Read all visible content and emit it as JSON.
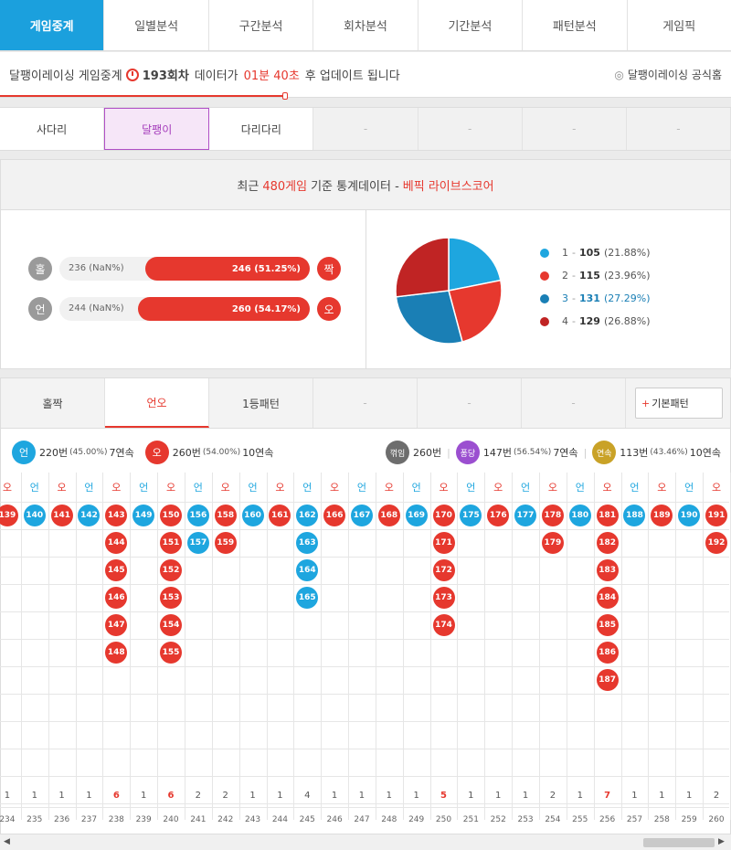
{
  "nav": {
    "tabs": [
      "게임중계",
      "일별분석",
      "구간분석",
      "회차분석",
      "기간분석",
      "패턴분석",
      "게임픽"
    ],
    "active": 0
  },
  "info": {
    "prefix": "달팽이레이싱 게임중계",
    "round": "193회차",
    "mid": "데이터가",
    "time": "01분 40초",
    "suffix": "후 업데이트 됩니다",
    "official": "달팽이레이싱 공식홈"
  },
  "game_tabs": [
    "사다리",
    "달팽이",
    "다리다리",
    "-",
    "-",
    "-",
    "-"
  ],
  "stats": {
    "head_a": "최근",
    "head_count": "480게임",
    "head_b": "기준 통계데이터 -",
    "head_brand": "베픽 라이브스코어",
    "rows": [
      {
        "left_label": "홀",
        "left_text": "236 (NaN%)",
        "right_text": "246 (51.25%)",
        "right_label": "짝",
        "right_pct": 51.25
      },
      {
        "left_label": "언",
        "left_text": "244 (NaN%)",
        "right_text": "260 (54.17%)",
        "right_label": "오",
        "right_pct": 54.17
      }
    ],
    "legend": [
      {
        "num": "1",
        "val": "105",
        "pct": "(21.88%)",
        "color": "#1ea6df"
      },
      {
        "num": "2",
        "val": "115",
        "pct": "(23.96%)",
        "color": "#e6382e"
      },
      {
        "num": "3",
        "val": "131",
        "pct": "(27.29%)",
        "color": "#1a7fb5"
      },
      {
        "num": "4",
        "val": "129",
        "pct": "(26.88%)",
        "color": "#c02424"
      }
    ]
  },
  "pattern": {
    "tabs": [
      "홀짝",
      "언오",
      "1등패턴",
      "-",
      "-",
      "-"
    ],
    "add_button": "기본패턴",
    "summary": {
      "a_label": "언",
      "a_text": "220번",
      "a_pct": "(45.00%)",
      "a_streak": "7연속",
      "b_label": "오",
      "b_text": "260번",
      "b_pct": "(54.00%)",
      "b_streak": "10연속",
      "c_label": "꺾임",
      "c_text": "260번",
      "d_label": "퐁당",
      "d_text": "147번",
      "d_pct": "(56.54%)",
      "d_streak": "7연속",
      "e_label": "연속",
      "e_text": "113번",
      "e_pct": "(43.46%)",
      "e_streak": "10연속"
    },
    "columns": [
      {
        "h": "오",
        "c": "red",
        "b": [
          "139"
        ],
        "n": "1",
        "r": "234"
      },
      {
        "h": "언",
        "c": "blue",
        "b": [
          "140"
        ],
        "n": "1",
        "r": "235"
      },
      {
        "h": "오",
        "c": "red",
        "b": [
          "141"
        ],
        "n": "1",
        "r": "236"
      },
      {
        "h": "언",
        "c": "blue",
        "b": [
          "142"
        ],
        "n": "1",
        "r": "237"
      },
      {
        "h": "오",
        "c": "red",
        "b": [
          "143",
          "144",
          "145",
          "146",
          "147",
          "148"
        ],
        "n": "6",
        "r": "238"
      },
      {
        "h": "언",
        "c": "blue",
        "b": [
          "149"
        ],
        "n": "1",
        "r": "239"
      },
      {
        "h": "오",
        "c": "red",
        "b": [
          "150",
          "151",
          "152",
          "153",
          "154",
          "155"
        ],
        "n": "6",
        "r": "240"
      },
      {
        "h": "언",
        "c": "blue",
        "b": [
          "156",
          "157"
        ],
        "n": "2",
        "r": "241"
      },
      {
        "h": "오",
        "c": "red",
        "b": [
          "158",
          "159"
        ],
        "n": "2",
        "r": "242"
      },
      {
        "h": "언",
        "c": "blue",
        "b": [
          "160"
        ],
        "n": "1",
        "r": "243"
      },
      {
        "h": "오",
        "c": "red",
        "b": [
          "161"
        ],
        "n": "1",
        "r": "244"
      },
      {
        "h": "언",
        "c": "blue",
        "b": [
          "162",
          "163",
          "164",
          "165"
        ],
        "n": "4",
        "r": "245"
      },
      {
        "h": "오",
        "c": "red",
        "b": [
          "166"
        ],
        "n": "1",
        "r": "246"
      },
      {
        "h": "언",
        "c": "blue",
        "b": [
          "167"
        ],
        "n": "1",
        "r": "247"
      },
      {
        "h": "오",
        "c": "red",
        "b": [
          "168"
        ],
        "n": "1",
        "r": "248"
      },
      {
        "h": "언",
        "c": "blue",
        "b": [
          "169"
        ],
        "n": "1",
        "r": "249"
      },
      {
        "h": "오",
        "c": "red",
        "b": [
          "170",
          "171",
          "172",
          "173",
          "174"
        ],
        "n": "5",
        "r": "250"
      },
      {
        "h": "언",
        "c": "blue",
        "b": [
          "175"
        ],
        "n": "1",
        "r": "251"
      },
      {
        "h": "오",
        "c": "red",
        "b": [
          "176"
        ],
        "n": "1",
        "r": "252"
      },
      {
        "h": "언",
        "c": "blue",
        "b": [
          "177"
        ],
        "n": "1",
        "r": "253"
      },
      {
        "h": "오",
        "c": "red",
        "b": [
          "178",
          "179"
        ],
        "n": "2",
        "r": "254"
      },
      {
        "h": "언",
        "c": "blue",
        "b": [
          "180"
        ],
        "n": "1",
        "r": "255"
      },
      {
        "h": "오",
        "c": "red",
        "b": [
          "181",
          "182",
          "183",
          "184",
          "185",
          "186",
          "187"
        ],
        "n": "7",
        "r": "256"
      },
      {
        "h": "언",
        "c": "blue",
        "b": [
          "188"
        ],
        "n": "1",
        "r": "257"
      },
      {
        "h": "오",
        "c": "red",
        "b": [
          "189"
        ],
        "n": "1",
        "r": "258"
      },
      {
        "h": "언",
        "c": "blue",
        "b": [
          "190"
        ],
        "n": "1",
        "r": "259"
      },
      {
        "h": "오",
        "c": "red",
        "b": [
          "191",
          "192"
        ],
        "n": "2",
        "r": "260"
      }
    ]
  }
}
